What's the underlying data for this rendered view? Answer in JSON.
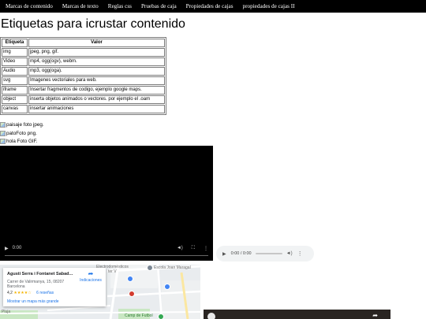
{
  "nav": {
    "items": [
      "Marcas de contenido",
      "Marcas de texto",
      "Reglas css",
      "Pruebas de caja",
      "Propiedades de cajas",
      "propiedades de cajas II"
    ]
  },
  "page": {
    "title": "Etiquetas para icrustar contenido"
  },
  "table": {
    "headers": [
      "Etiqueta",
      "Valor"
    ],
    "rows": [
      {
        "tag": "img",
        "value": "jpeg, png, gif."
      },
      {
        "tag": "Video",
        "value": "mp4, ogg(ogv), webm."
      },
      {
        "tag": "Audio",
        "value": "mp3, ogg(oga)."
      },
      {
        "tag": "svg",
        "value": "Imagenes vectoriales para web."
      },
      {
        "tag": "iframe",
        "value": "Insertar fragmentos de codigo, ejemplo google maps."
      },
      {
        "tag": "object",
        "value": "inserta objetos animados o vectores. por ejemplo el .oam"
      },
      {
        "tag": "canvas",
        "value": "insertar animaciones"
      }
    ]
  },
  "images": [
    {
      "alt": "paisaje",
      "caption": "foto jpeg."
    },
    {
      "alt": "pato",
      "caption": "Foto png."
    },
    {
      "alt": "hola",
      "caption": "Foto GIF."
    }
  ],
  "video": {
    "time": "0:00"
  },
  "audio": {
    "time": "0:00 / 0:00"
  },
  "map": {
    "place_name": "Agustí Serra i Fontanet Sabad...",
    "address_line1": "Carrer de Valirmanya, 15, 08207",
    "address_line2": "Barcelona",
    "rating": "4,2",
    "stars": "★★★★☆",
    "reviews": "6 reseñas",
    "directions": "Indicaciones",
    "larger_map": "Mostrar un mapa más grande",
    "poi_1": "Electrodomésticos",
    "poi_1b": "ter V",
    "poi_2": "Escola Joan Maragal",
    "poi_3": "Camp de Futbol",
    "road_1": "Pluja"
  },
  "colors": {
    "nav_bg": "#000000",
    "link_blue": "#1a73e8",
    "star": "#f4b400",
    "map_park": "#c9e7c3"
  }
}
